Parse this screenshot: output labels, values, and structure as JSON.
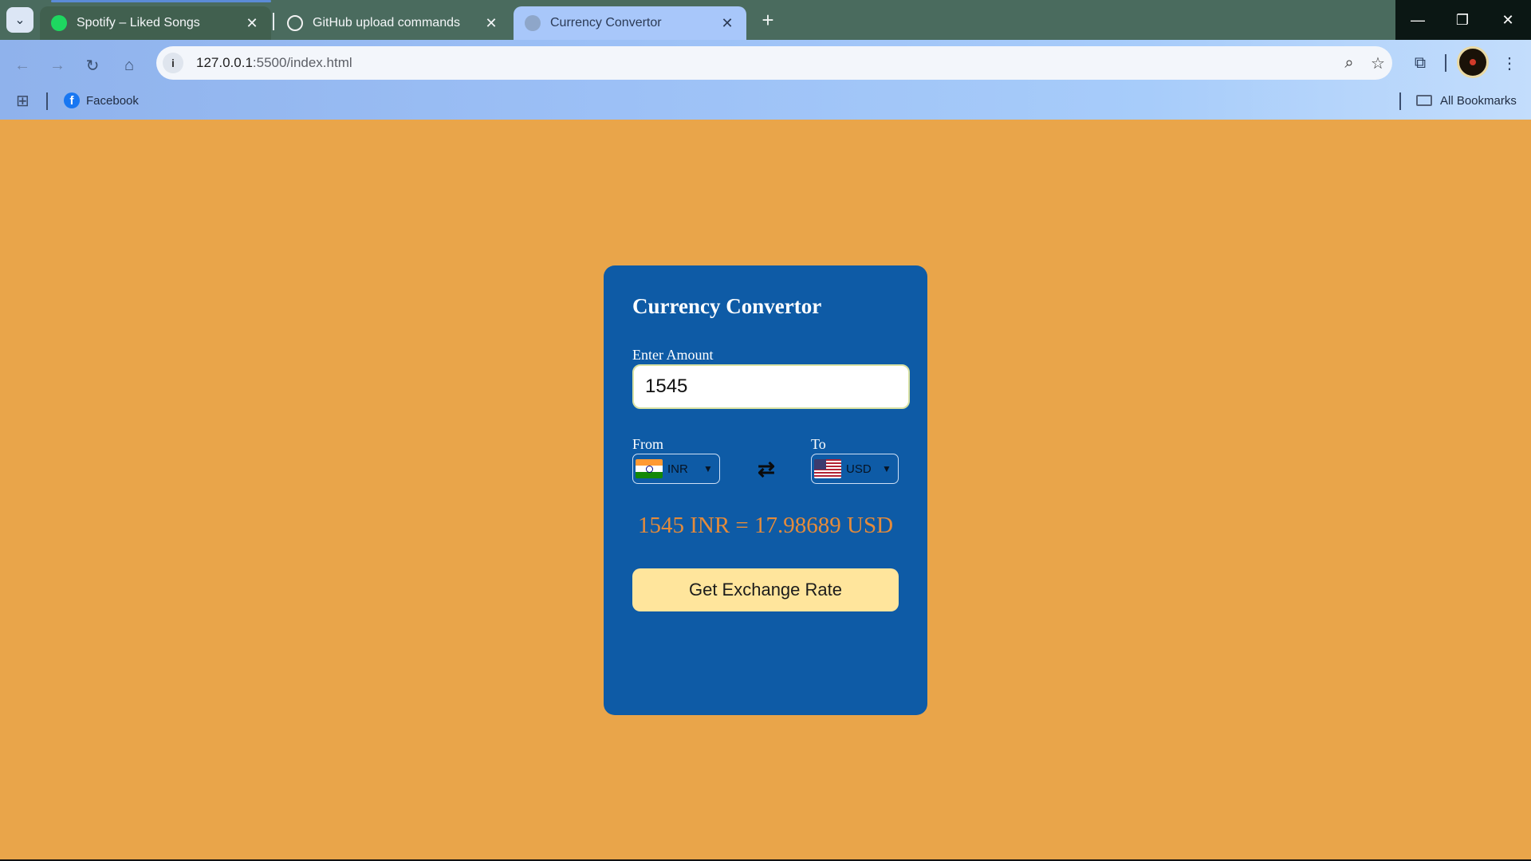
{
  "browser": {
    "tabs": [
      {
        "title": "Spotify – Liked Songs",
        "favicon": "spotify-icon",
        "active": false
      },
      {
        "title": "GitHub upload commands",
        "favicon": "openai-icon",
        "active": false
      },
      {
        "title": "Currency Convertor",
        "favicon": "globe-icon",
        "active": true
      }
    ],
    "address": {
      "host": "127.0.0.1",
      "path": ":5500/index.html"
    },
    "bookmarks": [
      {
        "label": "Facebook",
        "icon": "facebook-icon"
      }
    ],
    "all_bookmarks_label": "All Bookmarks",
    "colors": {
      "tabbar": "#4A6B5E",
      "active_tab": "#A8C7FA",
      "toolbar": "#9CC0F6"
    }
  },
  "app": {
    "title": "Currency Convertor",
    "amount_label": "Enter Amount",
    "amount_value": "1545",
    "from_label": "From",
    "to_label": "To",
    "from_currency": "INR",
    "to_currency": "USD",
    "result_text": "1545 INR = 17.98689 USD",
    "button_label": "Get Exchange Rate",
    "colors": {
      "background": "#E9A54A",
      "card": "#0E5BA6",
      "result": "#E58B3A",
      "button": "#FFE59C"
    }
  }
}
